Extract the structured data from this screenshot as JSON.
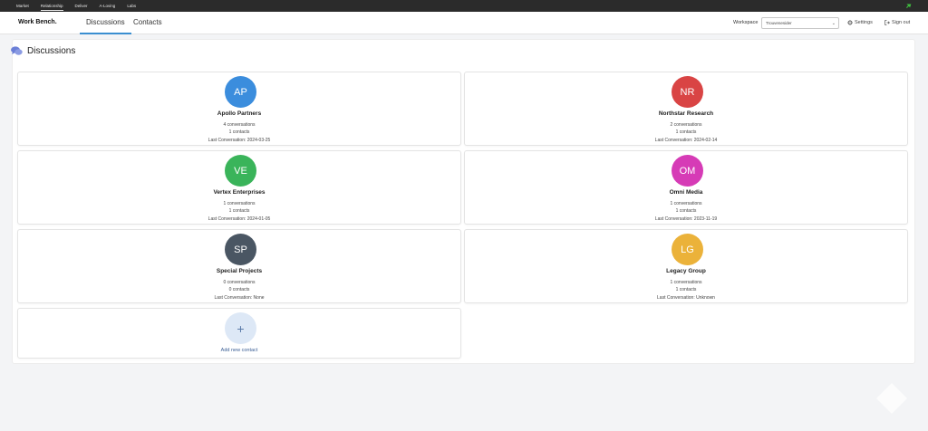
{
  "topnav": {
    "items": [
      "Market",
      "Relationship",
      "Deliver",
      "A-Loving",
      "Labs"
    ],
    "active_index": 1
  },
  "header": {
    "brand": "Work Bench.",
    "tabs": [
      {
        "label": "Discussions",
        "active": true
      },
      {
        "label": "Contacts",
        "active": false
      }
    ],
    "workspace_label": "Workspace",
    "workspace_value": "Trouvenesider",
    "settings_label": "Settings",
    "signout_label": "Sign out"
  },
  "page": {
    "title": "Discussions"
  },
  "contacts": [
    {
      "initials": "AP",
      "name": "Apollo Partners",
      "conversations": "4 conversations",
      "contacts": "1 contacts",
      "last": "Last Conversation: 2024-03-25",
      "color": "#3b8ddd"
    },
    {
      "initials": "NR",
      "name": "Northstar Research",
      "conversations": "2 conversations",
      "contacts": "1 contacts",
      "last": "Last Conversation: 2024-02-14",
      "color": "#d94444"
    },
    {
      "initials": "VE",
      "name": "Vertex Enterprises",
      "conversations": "1 conversations",
      "contacts": "1 contacts",
      "last": "Last Conversation: 2024-01-05",
      "color": "#3ab45a"
    },
    {
      "initials": "OM",
      "name": "Omni Media",
      "conversations": "1 conversations",
      "contacts": "1 contacts",
      "last": "Last Conversation: 2023-11-19",
      "color": "#d63bb6"
    },
    {
      "initials": "SP",
      "name": "Special Projects",
      "conversations": "0 conversations",
      "contacts": "0 contacts",
      "last": "Last Conversation: None",
      "color": "#4a5663"
    },
    {
      "initials": "LG",
      "name": "Legacy Group",
      "conversations": "1 conversations",
      "contacts": "1 contacts",
      "last": "Last Conversation: Unknown",
      "color": "#ebb23a"
    }
  ],
  "add_card": {
    "icon": "+",
    "label": "Add new contact"
  },
  "colors": {
    "accent": "#3a8ed0",
    "topbar": "#2b2b2b",
    "pin": "#3fbf3f"
  }
}
